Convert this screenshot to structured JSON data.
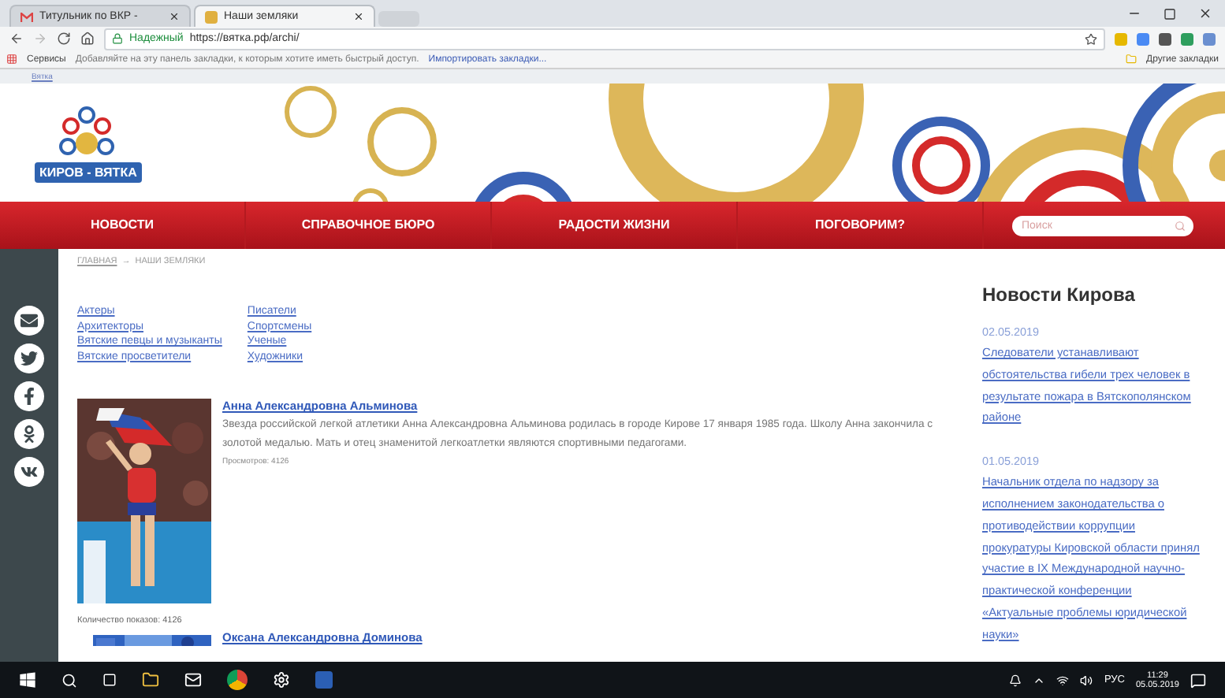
{
  "browser": {
    "tabs": [
      {
        "title": "Титульник по ВКР - ",
        "selected": false
      },
      {
        "title": "Наши земляки",
        "selected": true
      }
    ],
    "secure_label": "Надежный",
    "url": "https://вятка.рф/archi/",
    "bookmarks": {
      "apps": "Сервисы",
      "hint": "Добавляйте на эту панель закладки, к которым хотите иметь быстрый доступ.",
      "import": "Импортировать закладки...",
      "other": "Другие закладки"
    }
  },
  "top_strip": "Вятка",
  "logo": {
    "text": "КИРОВ - ВЯТКА"
  },
  "nav": {
    "items": [
      "НОВОСТИ",
      "СПРАВОЧНОЕ БЮРО",
      "РАДОСТИ ЖИЗНИ",
      "ПОГОВОРИМ?"
    ],
    "search": {
      "placeholder": "Поиск"
    }
  },
  "breadcrumb": {
    "home": "ГЛАВНАЯ",
    "separator": "→",
    "current": "НАШИ ЗЕМЛЯКИ"
  },
  "categories": [
    [
      "Актеры",
      "Архитекторы",
      "Вятские певцы и музыканты",
      "Вятские просветители"
    ],
    [
      "Писатели",
      "Спортсмены",
      "Ученые",
      "Художники"
    ]
  ],
  "articles": [
    {
      "name": "Анна Александровна Альминова",
      "text": "Звезда российской легкой атлетики Анна Александровна Альминова родилась в городе Кирове 17 января 1985 года. Школу Анна закончила с золотой медалью. Мать и отец знаменитой легкоатлетки являются спортивными педагогами.",
      "views": "Просмотров: 4126",
      "shows": "Количество показов: 4126",
      "kind": "picture"
    },
    {
      "name": "Оксана Александровна Доминова",
      "kind": "picture"
    }
  ],
  "news": {
    "title": "Новости Кирова",
    "items": [
      {
        "date": "02.05.2019",
        "text": "Следователи устанавливают обстоятельства гибели трех человек в результате пожара в Вятскополянском районе"
      },
      {
        "date": "01.05.2019",
        "text": "Начальник отдела по надзору за исполнением законодательства о противодействии коррупции прокуратуры Кировской области принял участие в IX Международной научно-практической конференции «Актуальные проблемы юридической науки»"
      }
    ]
  },
  "taskbar": {
    "language": "РУС",
    "time": "11:29",
    "date": "05.05.2019"
  }
}
